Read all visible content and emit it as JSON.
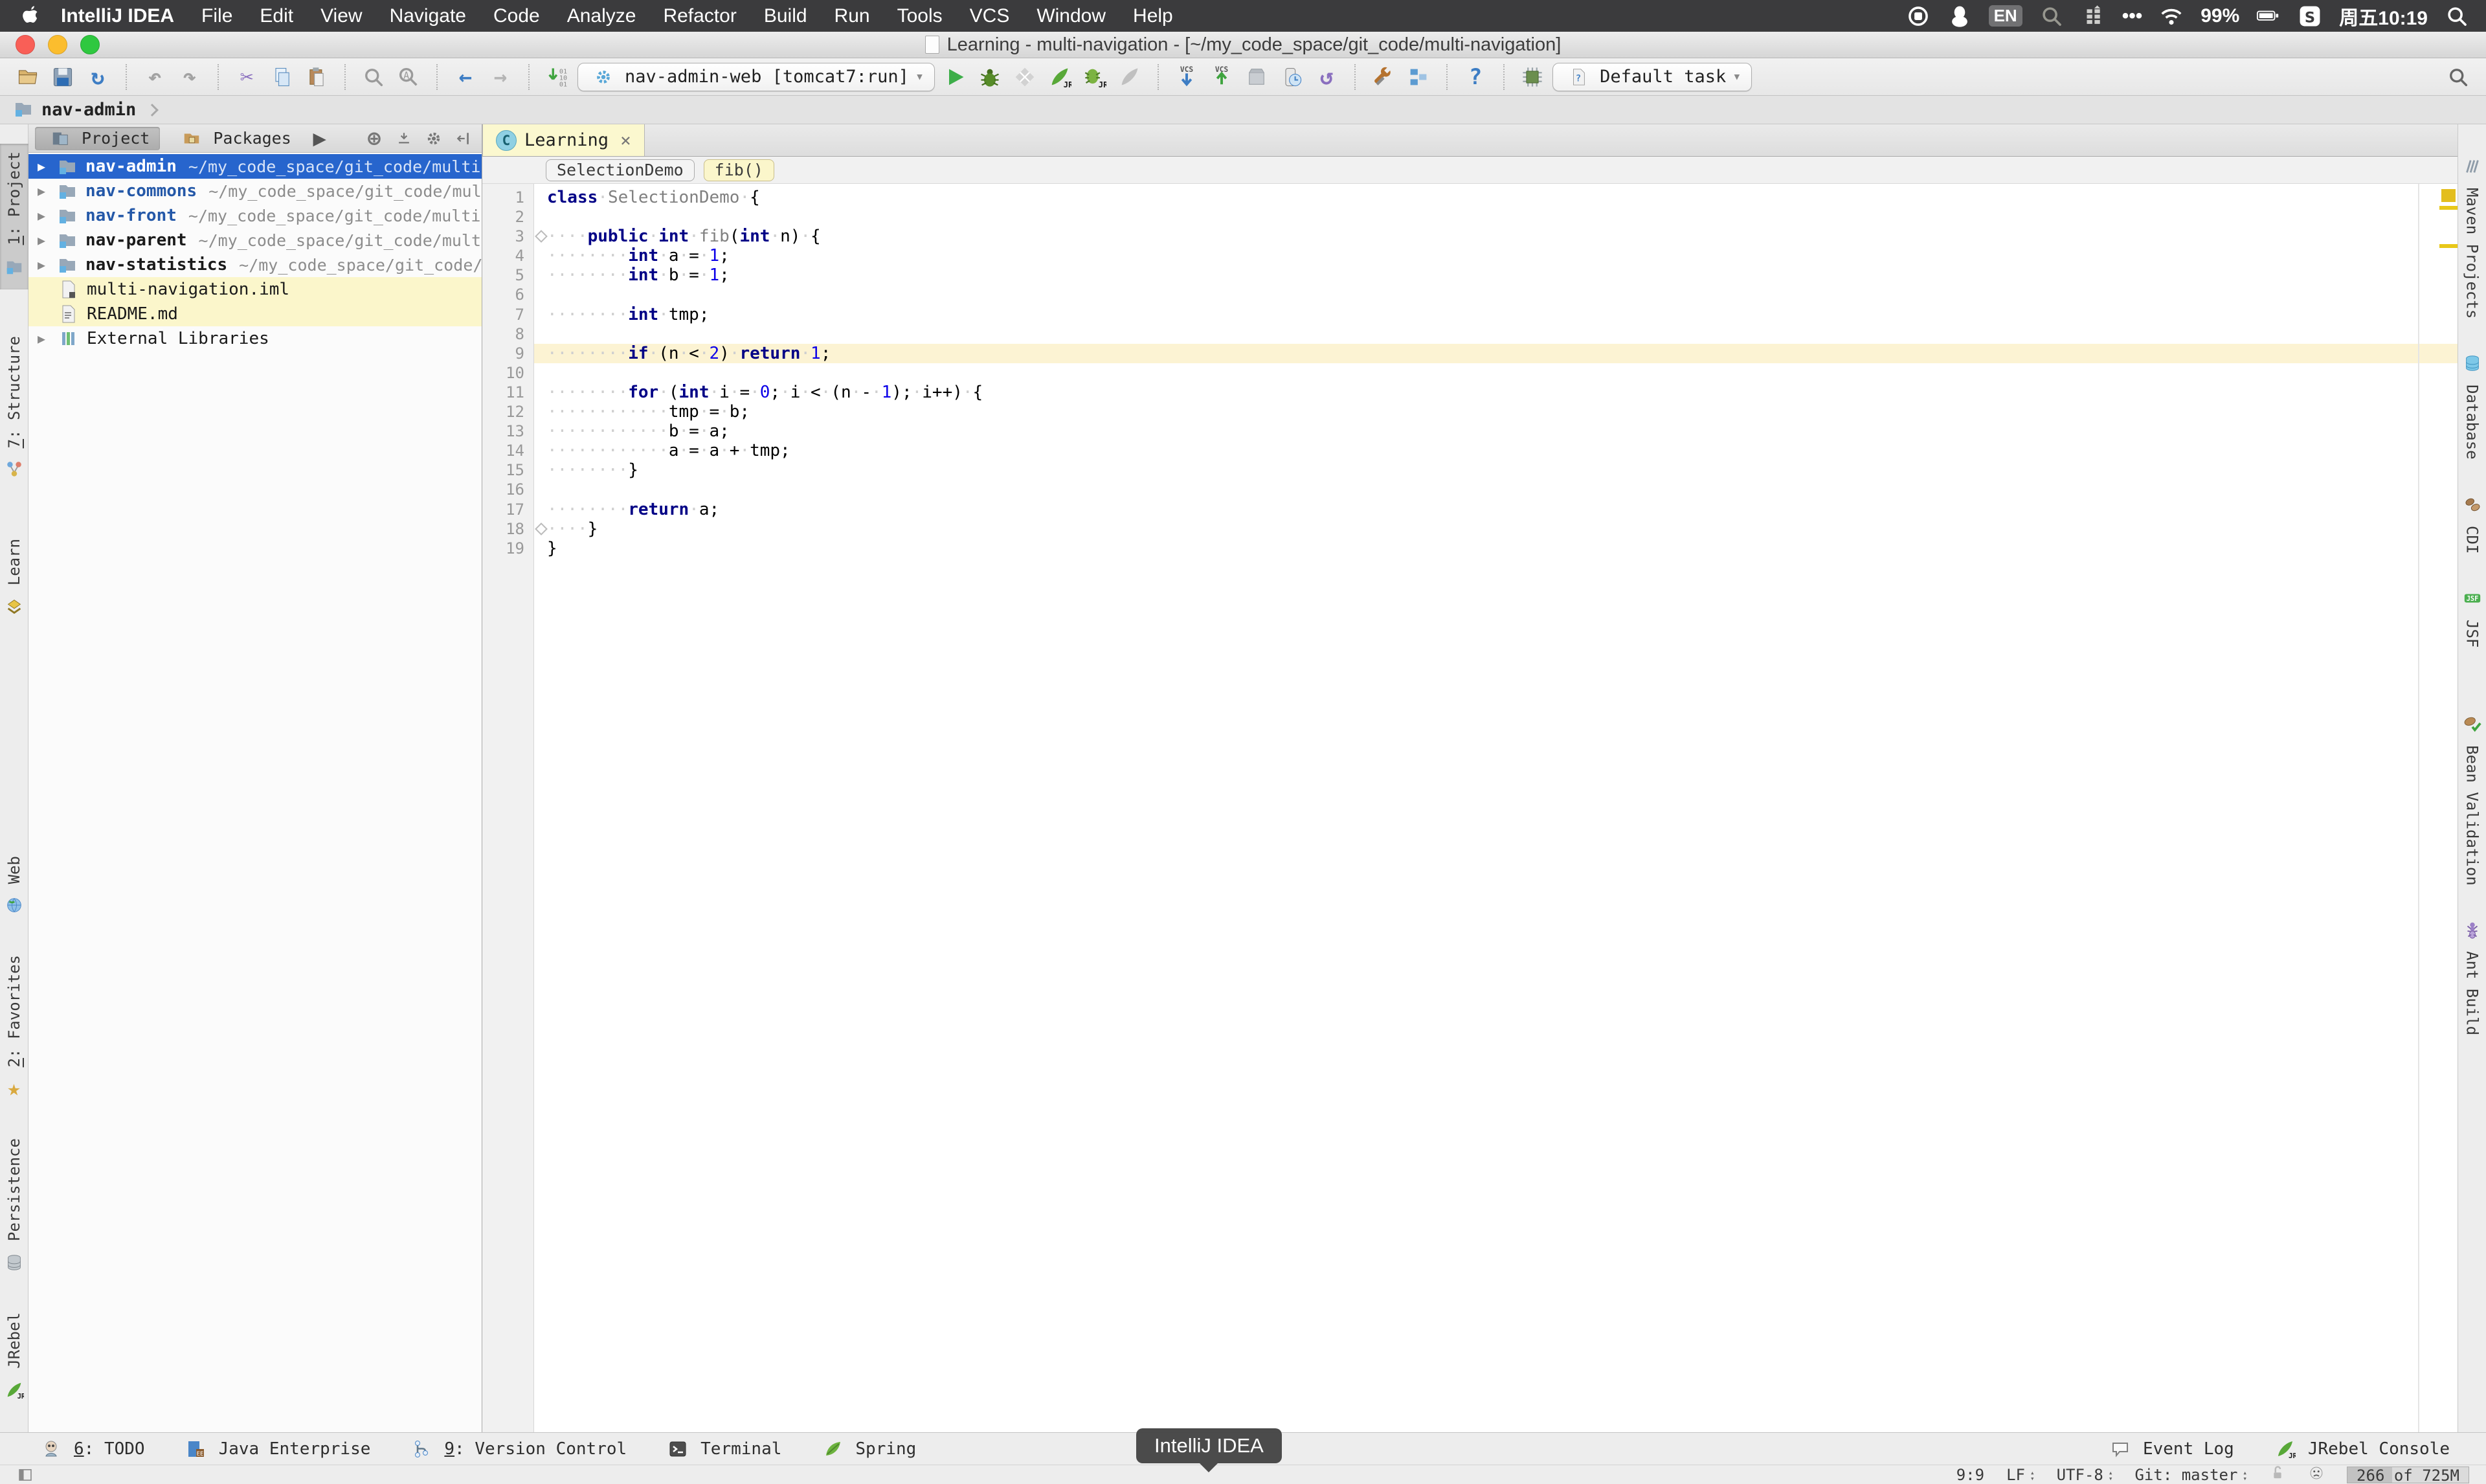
{
  "window": {
    "title": "Learning - multi-navigation - [~/my_code_space/git_code/multi-navigation]"
  },
  "menu_bar": {
    "items": [
      "IntelliJ IDEA",
      "File",
      "Edit",
      "View",
      "Navigate",
      "Code",
      "Analyze",
      "Refactor",
      "Build",
      "Run",
      "Tools",
      "VCS",
      "Window",
      "Help"
    ],
    "status_items": [
      {
        "icon": "screen-record"
      },
      {
        "icon": "qq"
      },
      {
        "chip": "EN"
      },
      {
        "icon": "spotlight-dim"
      },
      {
        "icon": "input-switcher"
      },
      {
        "text": "•••"
      },
      {
        "icon": "wifi"
      },
      {
        "text": "99%"
      },
      {
        "icon": "battery"
      },
      {
        "icon": "sogou"
      },
      {
        "text": "周五10:19"
      },
      {
        "icon": "search-white"
      }
    ]
  },
  "toolbar": {
    "run_config": {
      "icon": "run-config-gear",
      "label": "nav-admin-web [tomcat7:run]"
    },
    "default_task": {
      "icon": "task-doc",
      "label": "Default task"
    },
    "groups": [
      [
        "open-file",
        "save-all",
        "synchronize"
      ],
      [
        "undo",
        "redo"
      ],
      [
        "cut",
        "copy",
        "paste"
      ],
      [
        "find",
        "replace"
      ],
      [
        "back",
        "forward"
      ],
      [
        "binary-view",
        {
          "combo": "run_config"
        },
        "run",
        "debug",
        "coverage",
        "jrebel-run",
        "jrebel-debug",
        "jrebel-disabled"
      ],
      [
        "vcs-update",
        "vcs-commit",
        "shelf",
        "attach-debugger",
        "rollback"
      ],
      [
        "settings",
        "project-structure"
      ],
      [
        "help"
      ],
      [
        "jrebel-chip",
        {
          "combo": "default_task"
        }
      ]
    ],
    "search_icon": "search-gray"
  },
  "nav_bar": {
    "label": "nav-admin"
  },
  "project_panel": {
    "tabs": [
      {
        "label": "Project",
        "icon": "project-tab",
        "active": true
      },
      {
        "label": "Packages",
        "icon": "packages-tab",
        "active": false
      }
    ],
    "header_icons": [
      "expand-more",
      "locate",
      "collapse-all",
      "settings-gear",
      "dock"
    ],
    "tree": [
      {
        "icon": "module-folder",
        "expand": true,
        "name": "nav-admin",
        "path": "~/my_code_space/git_code/multi-n",
        "row": "selected",
        "name_style": "bold"
      },
      {
        "icon": "module-folder",
        "expand": true,
        "name": "nav-commons",
        "path": "~/my_code_space/git_code/multi",
        "row": "normal",
        "name_style": "blue"
      },
      {
        "icon": "module-folder",
        "expand": true,
        "name": "nav-front",
        "path": "~/my_code_space/git_code/multi-n",
        "row": "normal",
        "name_style": "blue"
      },
      {
        "icon": "module-folder",
        "expand": true,
        "name": "nav-parent",
        "path": "~/my_code_space/git_code/multi-",
        "row": "normal",
        "name_style": "bold"
      },
      {
        "icon": "module-folder",
        "expand": true,
        "name": "nav-statistics",
        "path": "~/my_code_space/git_code/mu",
        "row": "normal",
        "name_style": "bold"
      },
      {
        "icon": "iml-file",
        "expand": false,
        "name": "multi-navigation.iml",
        "path": "",
        "row": "yellow",
        "name_style": "plain"
      },
      {
        "icon": "md-file",
        "expand": false,
        "name": "README.md",
        "path": "",
        "row": "yellow",
        "name_style": "plain"
      },
      {
        "icon": "libraries",
        "expand": true,
        "name": "External Libraries",
        "path": "",
        "row": "normal",
        "name_style": "plain"
      }
    ]
  },
  "editor": {
    "tab": {
      "icon_letter": "C",
      "label": "Learning",
      "close": "×"
    },
    "breadcrumbs": [
      {
        "label": "SelectionDemo",
        "style": "plain"
      },
      {
        "label": "fib()",
        "style": "yellow"
      }
    ],
    "caret_line": 9,
    "lines": [
      {
        "n": 1,
        "segs": [
          {
            "c": "k",
            "t": "class"
          },
          {
            "c": "d",
            "t": " "
          },
          {
            "c": "g",
            "t": "SelectionDemo"
          },
          {
            "c": "d",
            "t": " {"
          }
        ]
      },
      {
        "n": 2,
        "segs": []
      },
      {
        "n": 3,
        "segs": [
          {
            "c": "d",
            "t": "    "
          },
          {
            "c": "k",
            "t": "public"
          },
          {
            "c": "d",
            "t": " "
          },
          {
            "c": "k",
            "t": "int"
          },
          {
            "c": "d",
            "t": " "
          },
          {
            "c": "g",
            "t": "fib"
          },
          {
            "c": "d",
            "t": "("
          },
          {
            "c": "k",
            "t": "int"
          },
          {
            "c": "d",
            "t": " n) {"
          }
        ]
      },
      {
        "n": 4,
        "segs": [
          {
            "c": "d",
            "t": "        "
          },
          {
            "c": "k",
            "t": "int"
          },
          {
            "c": "d",
            "t": " a = "
          },
          {
            "c": "n",
            "t": "1"
          },
          {
            "c": "d",
            "t": ";"
          }
        ]
      },
      {
        "n": 5,
        "segs": [
          {
            "c": "d",
            "t": "        "
          },
          {
            "c": "k",
            "t": "int"
          },
          {
            "c": "d",
            "t": " b = "
          },
          {
            "c": "n",
            "t": "1"
          },
          {
            "c": "d",
            "t": ";"
          }
        ]
      },
      {
        "n": 6,
        "segs": []
      },
      {
        "n": 7,
        "segs": [
          {
            "c": "d",
            "t": "        "
          },
          {
            "c": "k",
            "t": "int"
          },
          {
            "c": "d",
            "t": " tmp;"
          }
        ]
      },
      {
        "n": 8,
        "segs": []
      },
      {
        "n": 9,
        "segs": [
          {
            "c": "d",
            "t": "        "
          },
          {
            "c": "k",
            "t": "if"
          },
          {
            "c": "d",
            "t": " (n < "
          },
          {
            "c": "n",
            "t": "2"
          },
          {
            "c": "d",
            "t": ") "
          },
          {
            "c": "k",
            "t": "return"
          },
          {
            "c": "d",
            "t": " "
          },
          {
            "c": "n",
            "t": "1"
          },
          {
            "c": "d",
            "t": ";"
          }
        ]
      },
      {
        "n": 10,
        "segs": []
      },
      {
        "n": 11,
        "segs": [
          {
            "c": "d",
            "t": "        "
          },
          {
            "c": "k",
            "t": "for"
          },
          {
            "c": "d",
            "t": " ("
          },
          {
            "c": "k",
            "t": "int"
          },
          {
            "c": "d",
            "t": " i = "
          },
          {
            "c": "n",
            "t": "0"
          },
          {
            "c": "d",
            "t": "; i < (n - "
          },
          {
            "c": "n",
            "t": "1"
          },
          {
            "c": "d",
            "t": "); i++) {"
          }
        ]
      },
      {
        "n": 12,
        "segs": [
          {
            "c": "d",
            "t": "            tmp = b;"
          }
        ]
      },
      {
        "n": 13,
        "segs": [
          {
            "c": "d",
            "t": "            b = a;"
          }
        ]
      },
      {
        "n": 14,
        "segs": [
          {
            "c": "d",
            "t": "            a = a + tmp;"
          }
        ]
      },
      {
        "n": 15,
        "segs": [
          {
            "c": "d",
            "t": "        }"
          }
        ]
      },
      {
        "n": 16,
        "segs": []
      },
      {
        "n": 17,
        "segs": [
          {
            "c": "d",
            "t": "        "
          },
          {
            "c": "k",
            "t": "return"
          },
          {
            "c": "d",
            "t": " a;"
          }
        ]
      },
      {
        "n": 18,
        "segs": [
          {
            "c": "d",
            "t": "    }"
          }
        ]
      },
      {
        "n": 19,
        "segs": [
          {
            "c": "d",
            "t": "}"
          }
        ]
      }
    ]
  },
  "tool_windows": {
    "left_top": [
      {
        "mnemonic": "1",
        "label": ": Project",
        "icon": "project-tw",
        "active": true
      },
      {
        "mnemonic": "7",
        "label": ": Structure",
        "icon": "structure-tw",
        "active": false
      },
      {
        "mnemonic": "",
        "label": "Learn",
        "icon": "learn-tw",
        "active": false
      }
    ],
    "left_bottom": [
      {
        "mnemonic": "",
        "label": "Web",
        "icon": "web-tw",
        "active": false
      },
      {
        "mnemonic": "2",
        "label": ": Favorites",
        "icon": "favorites-tw",
        "active": false
      },
      {
        "mnemonic": "",
        "label": "Persistence",
        "icon": "persistence-tw",
        "active": false
      },
      {
        "mnemonic": "",
        "label": "JRebel",
        "icon": "jrebel-tw",
        "active": false
      }
    ],
    "right": [
      {
        "label": "Maven Projects",
        "icon": "maven-tw"
      },
      {
        "label": "Database",
        "icon": "database-tw"
      },
      {
        "label": "CDI",
        "icon": "cdi-tw"
      },
      {
        "label": "JSF",
        "icon": "jsf-tw"
      },
      {
        "label": "Bean Validation",
        "icon": "beanval-tw"
      },
      {
        "label": "Ant Build",
        "icon": "ant-tw"
      }
    ]
  },
  "bottom_bar": {
    "left": [
      {
        "mnemonic": "6",
        "label": ": TODO",
        "icon": "todo-tw"
      },
      {
        "mnemonic": "",
        "label": "Java Enterprise",
        "icon": "javaee-tw"
      },
      {
        "mnemonic": "9",
        "label": ": Version Control",
        "icon": "vcs-tw"
      },
      {
        "mnemonic": "",
        "label": "Terminal",
        "icon": "terminal-tw"
      },
      {
        "mnemonic": "",
        "label": "Spring",
        "icon": "spring-tw"
      }
    ],
    "right": [
      {
        "label": "Event Log",
        "icon": "event-log"
      },
      {
        "label": "JRebel Console",
        "icon": "jrebel-console"
      }
    ],
    "tooltip": "IntelliJ IDEA"
  },
  "status_bar": {
    "items": [
      {
        "text": "9:9"
      },
      {
        "text": "LF",
        "updown": true
      },
      {
        "text": "UTF-8",
        "updown": true
      },
      {
        "text": "Git: master",
        "updown": true
      },
      {
        "icon": "unlock"
      },
      {
        "icon": "hector"
      },
      {
        "memory": "266 of 725M"
      }
    ]
  },
  "glyphs": {
    "dropdown": "▾",
    "tree_expand": "▶",
    "up": "▴",
    "down": "▾"
  },
  "colors": {
    "selection": "#2765CD",
    "caret_line": "#FCF3D3",
    "yellow_row": "#FBF6CB",
    "keyword": "#000086",
    "number": "#0C00E8",
    "accent_blue": "#3D7DC4"
  }
}
